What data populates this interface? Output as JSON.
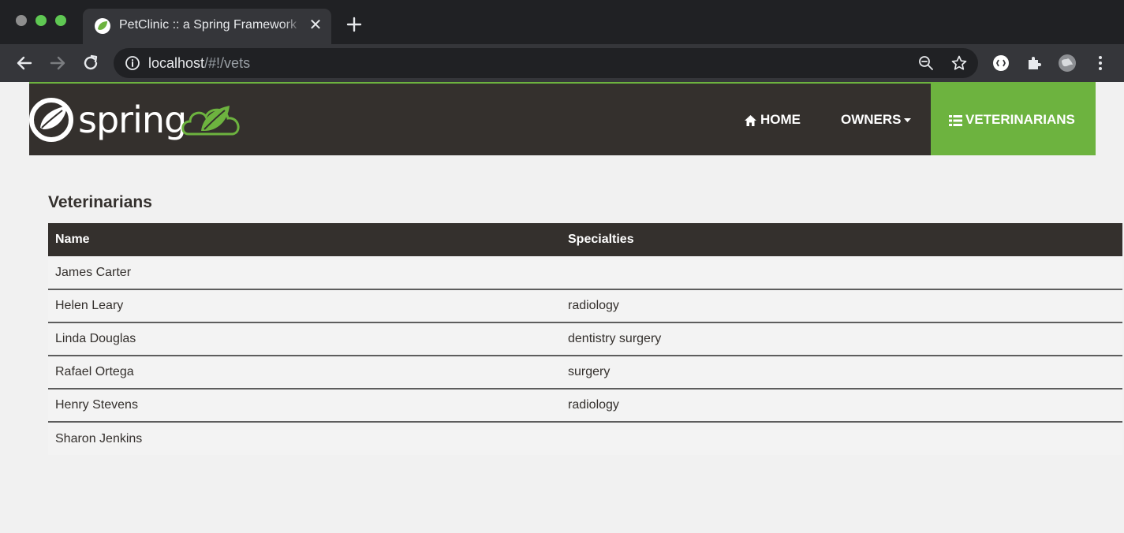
{
  "browser": {
    "tab_title": "PetClinic :: a Spring Framework",
    "url_host": "localhost",
    "url_path": "/#!/vets",
    "colors": {
      "frame": "#202124",
      "toolbar": "#35363a",
      "traffic_red": "#8e8e8e",
      "traffic_yellow": "#5fc853",
      "traffic_green": "#5fc853"
    }
  },
  "navbar": {
    "logo_text": "spring",
    "items": [
      {
        "label": "HOME",
        "icon": "home-icon"
      },
      {
        "label": "OWNERS",
        "icon": "caret-down-icon"
      },
      {
        "label": "VETERINARIANS",
        "icon": "list-icon",
        "active": true
      }
    ],
    "colors": {
      "background": "#34302d",
      "accent": "#6db33f"
    }
  },
  "main": {
    "title": "Veterinarians",
    "table": {
      "columns": [
        "Name",
        "Specialties"
      ],
      "rows": [
        {
          "name": "James Carter",
          "specialties": ""
        },
        {
          "name": "Helen Leary",
          "specialties": "radiology"
        },
        {
          "name": "Linda Douglas",
          "specialties": "dentistry surgery"
        },
        {
          "name": "Rafael Ortega",
          "specialties": "surgery"
        },
        {
          "name": "Henry Stevens",
          "specialties": "radiology"
        },
        {
          "name": "Sharon Jenkins",
          "specialties": ""
        }
      ]
    }
  }
}
